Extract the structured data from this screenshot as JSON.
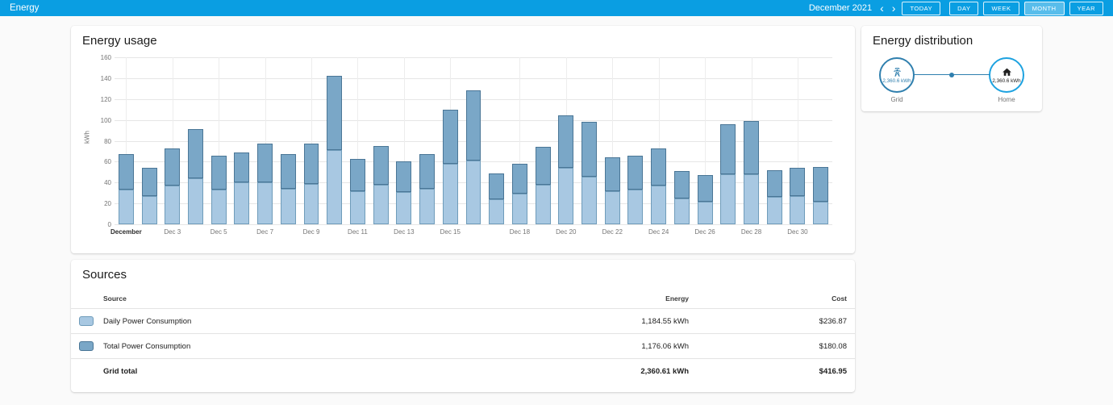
{
  "theme": {
    "header_bg": "#0a9ee2"
  },
  "header": {
    "title": "Energy",
    "period_label": "December 2021",
    "prev_icon": "‹",
    "next_icon": "›",
    "buttons": [
      {
        "label": "TODAY",
        "active": false
      },
      {
        "label": "DAY",
        "active": false
      },
      {
        "label": "WEEK",
        "active": false
      },
      {
        "label": "MONTH",
        "active": true
      },
      {
        "label": "YEAR",
        "active": false
      }
    ]
  },
  "usage_card": {
    "title": "Energy usage"
  },
  "chart_data": {
    "type": "bar",
    "stacked": true,
    "title": "Energy usage",
    "ylabel": "kWh",
    "ylim": [
      0,
      160
    ],
    "yticks": [
      0,
      20,
      40,
      60,
      80,
      100,
      120,
      140,
      160
    ],
    "grid": true,
    "legend_position": "none",
    "categories": [
      "Dec 1",
      "Dec 2",
      "Dec 3",
      "Dec 4",
      "Dec 5",
      "Dec 6",
      "Dec 7",
      "Dec 8",
      "Dec 9",
      "Dec 10",
      "Dec 11",
      "Dec 12",
      "Dec 13",
      "Dec 14",
      "Dec 15",
      "Dec 16",
      "Dec 17",
      "Dec 18",
      "Dec 19",
      "Dec 20",
      "Dec 21",
      "Dec 22",
      "Dec 23",
      "Dec 24",
      "Dec 25",
      "Dec 26",
      "Dec 27",
      "Dec 28",
      "Dec 29",
      "Dec 30",
      "Dec 31"
    ],
    "xticks": [
      {
        "index": 0,
        "label": "December",
        "bold": true
      },
      {
        "index": 2,
        "label": "Dec 3"
      },
      {
        "index": 4,
        "label": "Dec 5"
      },
      {
        "index": 6,
        "label": "Dec 7"
      },
      {
        "index": 8,
        "label": "Dec 9"
      },
      {
        "index": 10,
        "label": "Dec 11"
      },
      {
        "index": 12,
        "label": "Dec 13"
      },
      {
        "index": 14,
        "label": "Dec 15"
      },
      {
        "index": 17,
        "label": "Dec 18"
      },
      {
        "index": 19,
        "label": "Dec 20"
      },
      {
        "index": 21,
        "label": "Dec 22"
      },
      {
        "index": 23,
        "label": "Dec 24"
      },
      {
        "index": 25,
        "label": "Dec 26"
      },
      {
        "index": 27,
        "label": "Dec 28"
      },
      {
        "index": 29,
        "label": "Dec 30"
      }
    ],
    "series": [
      {
        "name": "Daily Power Consumption",
        "color": "#a8c8e2",
        "border": "#6f9cba",
        "values": [
          33,
          27,
          37,
          44,
          33,
          40,
          40,
          34,
          39,
          71,
          32,
          38,
          31,
          34,
          58,
          61,
          24,
          29,
          38,
          54,
          46,
          32,
          33,
          37,
          25,
          22,
          48,
          48,
          26,
          27,
          22
        ]
      },
      {
        "name": "Total Power Consumption",
        "color": "#7aa7c7",
        "border": "#4a7696",
        "values": [
          34,
          27,
          36,
          47,
          33,
          29,
          37,
          33,
          38,
          71,
          31,
          37,
          29,
          33,
          52,
          67,
          25,
          29,
          36,
          50,
          52,
          32,
          33,
          36,
          26,
          25,
          48,
          51,
          26,
          27,
          33
        ]
      }
    ]
  },
  "distribution_card": {
    "title": "Energy distribution",
    "line_color": "#2f7fae",
    "nodes": [
      {
        "id": "grid",
        "label": "Grid",
        "value": "2,360.6 kWh",
        "ring_color": "#2f7fae",
        "content_color": "#2f7fae"
      },
      {
        "id": "home",
        "label": "Home",
        "value": "2,360.6 kWh",
        "ring_color": "#1da2e0",
        "content_color": "#212121"
      }
    ]
  },
  "sources_card": {
    "title": "Sources",
    "columns": [
      "Source",
      "Energy",
      "Cost"
    ],
    "rows": [
      {
        "name": "Daily Power Consumption",
        "energy": "1,184.55 kWh",
        "cost": "$236.87",
        "color": "#a8c8e2",
        "border": "#6f9cba"
      },
      {
        "name": "Total Power Consumption",
        "energy": "1,176.06 kWh",
        "cost": "$180.08",
        "color": "#7aa7c7",
        "border": "#4a7696"
      }
    ],
    "total": {
      "name": "Grid total",
      "energy": "2,360.61 kWh",
      "cost": "$416.95"
    }
  }
}
